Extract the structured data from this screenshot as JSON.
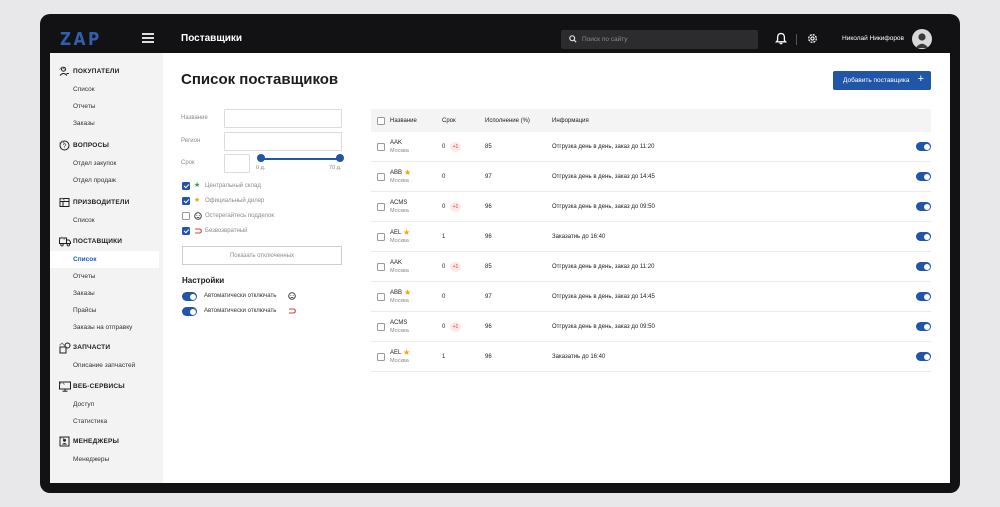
{
  "colors": {
    "accent": "#2055a8",
    "topbar": "#121214",
    "star": "#f0a500",
    "badge": "#d94040",
    "green_star": "#2e9e3d"
  },
  "topbar": {
    "logo": "ZAP",
    "page_name": "Поставщики",
    "search_placeholder": "Поиск по сайту",
    "user_name": "Николай Никифоров"
  },
  "sidebar": {
    "sections": [
      {
        "title": "ПОКУПАТЕЛИ",
        "icon": "customer-icon",
        "items": [
          "Список",
          "Отчеты",
          "Заказы"
        ]
      },
      {
        "title": "ВОПРОСЫ",
        "icon": "question-icon",
        "items": [
          "Отдел закупок",
          "Отдел продаж"
        ]
      },
      {
        "title": "ПРИЗВОДИТЕЛИ",
        "icon": "factory-icon",
        "items": [
          "Список"
        ]
      },
      {
        "title": "ПОСТАВЩИКИ",
        "icon": "truck-icon",
        "items": [
          "Список",
          "Отчеты",
          "Заказы",
          "Прайсы",
          "Заказы на отправку"
        ],
        "active_item": "Список"
      },
      {
        "title": "ЗАПЧАСТИ",
        "icon": "parts-icon",
        "items": [
          "Описание запчастей"
        ]
      },
      {
        "title": "ВЕБ-СЕРВИСЫ",
        "icon": "monitor-icon",
        "items": [
          "Доступ",
          "Статистика"
        ]
      },
      {
        "title": "МЕНЕДЖЕРЫ",
        "icon": "manager-icon",
        "items": [
          "Менеджеры"
        ]
      }
    ]
  },
  "main": {
    "title": "Список поставщиков",
    "add_button": "Добавить поставщика"
  },
  "filters": {
    "name_label": "Название",
    "region_label": "Регион",
    "term_label": "Срок",
    "range_min": "0 д.",
    "range_max": "70 д.",
    "checkboxes": [
      {
        "label": "Центральный склад",
        "checked": true,
        "icon": "green-star-icon"
      },
      {
        "label": "Официальный дилер",
        "checked": true,
        "icon": "orange-star-icon"
      },
      {
        "label": "Остерегайтесь подделок",
        "checked": false,
        "icon": "warning-face-icon"
      },
      {
        "label": "Безвозвратный",
        "checked": true,
        "icon": "return-arrow-icon"
      }
    ],
    "show_disabled_button": "Показать отключенных",
    "settings_title": "Настройки",
    "settings": [
      {
        "label": "Автоматически отключать",
        "icon": "warning-face-icon",
        "enabled": true
      },
      {
        "label": "Автоматически отключать",
        "icon": "return-arrow-icon",
        "enabled": true
      }
    ]
  },
  "table": {
    "headers": [
      "Название",
      "Срок",
      "Исполнение (%)",
      "Информация"
    ],
    "rows": [
      {
        "name": "AAK",
        "city": "Москва",
        "star": false,
        "term": "0",
        "badge": "+1",
        "exec": "85",
        "info": "Отгрузка день в день, заказ до 11:20",
        "enabled": true
      },
      {
        "name": "ABB",
        "city": "Москва",
        "star": true,
        "term": "0",
        "badge": "",
        "exec": "97",
        "info": "Отгрузка день в день, заказ до 14:45",
        "enabled": true
      },
      {
        "name": "ACMS",
        "city": "Москва",
        "star": false,
        "term": "0",
        "badge": "+1",
        "exec": "96",
        "info": "Отгрузка день в день, заказ до 09:50",
        "enabled": true
      },
      {
        "name": "AEL",
        "city": "Москва",
        "star": true,
        "term": "1",
        "badge": "",
        "exec": "96",
        "info": "Заказатиь до 16:40",
        "enabled": true
      },
      {
        "name": "AAK",
        "city": "Москва",
        "star": false,
        "term": "0",
        "badge": "+1",
        "exec": "85",
        "info": "Отгрузка день в день, заказ до 11:20",
        "enabled": true
      },
      {
        "name": "ABB",
        "city": "Москва",
        "star": true,
        "term": "0",
        "badge": "",
        "exec": "97",
        "info": "Отгрузка день в день, заказ до 14:45",
        "enabled": true
      },
      {
        "name": "ACMS",
        "city": "Москва",
        "star": false,
        "term": "0",
        "badge": "+1",
        "exec": "96",
        "info": "Отгрузка день в день, заказ до 09:50",
        "enabled": true
      },
      {
        "name": "AEL",
        "city": "Москва",
        "star": true,
        "term": "1",
        "badge": "",
        "exec": "96",
        "info": "Заказатиь до 16:40",
        "enabled": true
      }
    ]
  }
}
